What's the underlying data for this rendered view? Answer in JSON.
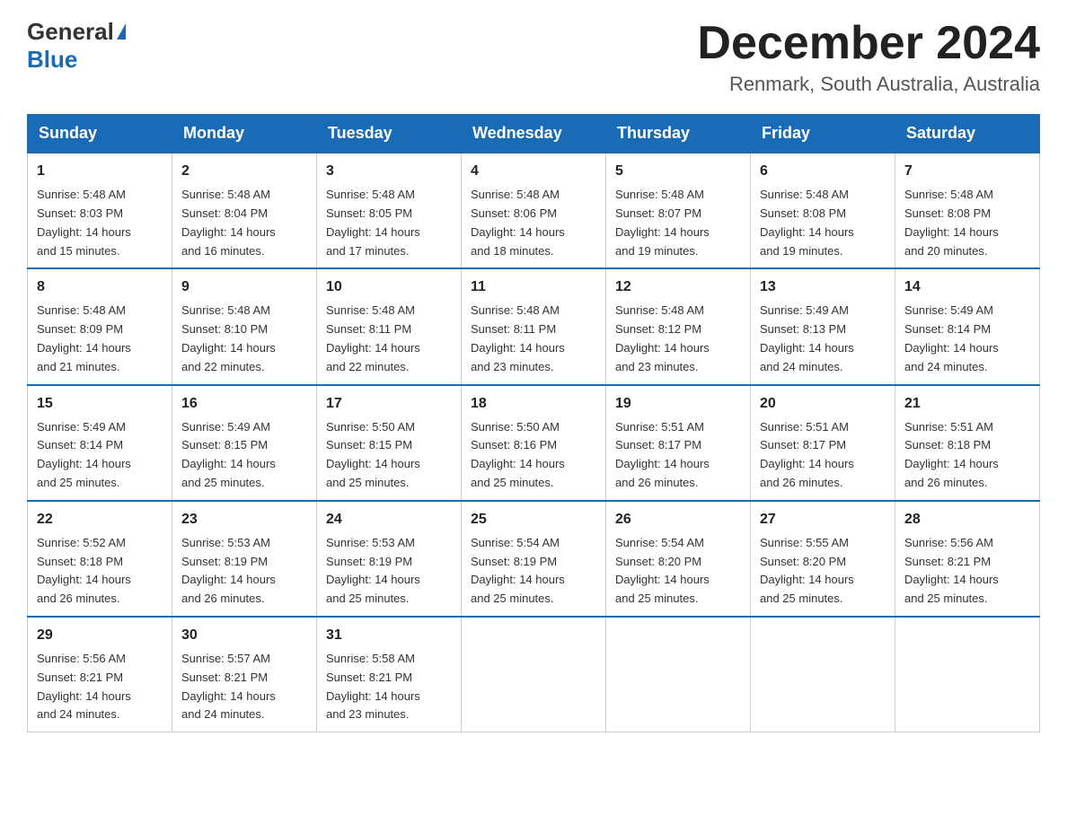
{
  "header": {
    "logo_general": "General",
    "logo_blue": "Blue",
    "month_title": "December 2024",
    "location": "Renmark, South Australia, Australia"
  },
  "days_of_week": [
    "Sunday",
    "Monday",
    "Tuesday",
    "Wednesday",
    "Thursday",
    "Friday",
    "Saturday"
  ],
  "weeks": [
    [
      {
        "day": "1",
        "sunrise": "5:48 AM",
        "sunset": "8:03 PM",
        "daylight": "14 hours and 15 minutes."
      },
      {
        "day": "2",
        "sunrise": "5:48 AM",
        "sunset": "8:04 PM",
        "daylight": "14 hours and 16 minutes."
      },
      {
        "day": "3",
        "sunrise": "5:48 AM",
        "sunset": "8:05 PM",
        "daylight": "14 hours and 17 minutes."
      },
      {
        "day": "4",
        "sunrise": "5:48 AM",
        "sunset": "8:06 PM",
        "daylight": "14 hours and 18 minutes."
      },
      {
        "day": "5",
        "sunrise": "5:48 AM",
        "sunset": "8:07 PM",
        "daylight": "14 hours and 19 minutes."
      },
      {
        "day": "6",
        "sunrise": "5:48 AM",
        "sunset": "8:08 PM",
        "daylight": "14 hours and 19 minutes."
      },
      {
        "day": "7",
        "sunrise": "5:48 AM",
        "sunset": "8:08 PM",
        "daylight": "14 hours and 20 minutes."
      }
    ],
    [
      {
        "day": "8",
        "sunrise": "5:48 AM",
        "sunset": "8:09 PM",
        "daylight": "14 hours and 21 minutes."
      },
      {
        "day": "9",
        "sunrise": "5:48 AM",
        "sunset": "8:10 PM",
        "daylight": "14 hours and 22 minutes."
      },
      {
        "day": "10",
        "sunrise": "5:48 AM",
        "sunset": "8:11 PM",
        "daylight": "14 hours and 22 minutes."
      },
      {
        "day": "11",
        "sunrise": "5:48 AM",
        "sunset": "8:11 PM",
        "daylight": "14 hours and 23 minutes."
      },
      {
        "day": "12",
        "sunrise": "5:48 AM",
        "sunset": "8:12 PM",
        "daylight": "14 hours and 23 minutes."
      },
      {
        "day": "13",
        "sunrise": "5:49 AM",
        "sunset": "8:13 PM",
        "daylight": "14 hours and 24 minutes."
      },
      {
        "day": "14",
        "sunrise": "5:49 AM",
        "sunset": "8:14 PM",
        "daylight": "14 hours and 24 minutes."
      }
    ],
    [
      {
        "day": "15",
        "sunrise": "5:49 AM",
        "sunset": "8:14 PM",
        "daylight": "14 hours and 25 minutes."
      },
      {
        "day": "16",
        "sunrise": "5:49 AM",
        "sunset": "8:15 PM",
        "daylight": "14 hours and 25 minutes."
      },
      {
        "day": "17",
        "sunrise": "5:50 AM",
        "sunset": "8:15 PM",
        "daylight": "14 hours and 25 minutes."
      },
      {
        "day": "18",
        "sunrise": "5:50 AM",
        "sunset": "8:16 PM",
        "daylight": "14 hours and 25 minutes."
      },
      {
        "day": "19",
        "sunrise": "5:51 AM",
        "sunset": "8:17 PM",
        "daylight": "14 hours and 26 minutes."
      },
      {
        "day": "20",
        "sunrise": "5:51 AM",
        "sunset": "8:17 PM",
        "daylight": "14 hours and 26 minutes."
      },
      {
        "day": "21",
        "sunrise": "5:51 AM",
        "sunset": "8:18 PM",
        "daylight": "14 hours and 26 minutes."
      }
    ],
    [
      {
        "day": "22",
        "sunrise": "5:52 AM",
        "sunset": "8:18 PM",
        "daylight": "14 hours and 26 minutes."
      },
      {
        "day": "23",
        "sunrise": "5:53 AM",
        "sunset": "8:19 PM",
        "daylight": "14 hours and 26 minutes."
      },
      {
        "day": "24",
        "sunrise": "5:53 AM",
        "sunset": "8:19 PM",
        "daylight": "14 hours and 25 minutes."
      },
      {
        "day": "25",
        "sunrise": "5:54 AM",
        "sunset": "8:19 PM",
        "daylight": "14 hours and 25 minutes."
      },
      {
        "day": "26",
        "sunrise": "5:54 AM",
        "sunset": "8:20 PM",
        "daylight": "14 hours and 25 minutes."
      },
      {
        "day": "27",
        "sunrise": "5:55 AM",
        "sunset": "8:20 PM",
        "daylight": "14 hours and 25 minutes."
      },
      {
        "day": "28",
        "sunrise": "5:56 AM",
        "sunset": "8:21 PM",
        "daylight": "14 hours and 25 minutes."
      }
    ],
    [
      {
        "day": "29",
        "sunrise": "5:56 AM",
        "sunset": "8:21 PM",
        "daylight": "14 hours and 24 minutes."
      },
      {
        "day": "30",
        "sunrise": "5:57 AM",
        "sunset": "8:21 PM",
        "daylight": "14 hours and 24 minutes."
      },
      {
        "day": "31",
        "sunrise": "5:58 AM",
        "sunset": "8:21 PM",
        "daylight": "14 hours and 23 minutes."
      },
      null,
      null,
      null,
      null
    ]
  ],
  "labels": {
    "sunrise": "Sunrise:",
    "sunset": "Sunset:",
    "daylight": "Daylight:"
  }
}
